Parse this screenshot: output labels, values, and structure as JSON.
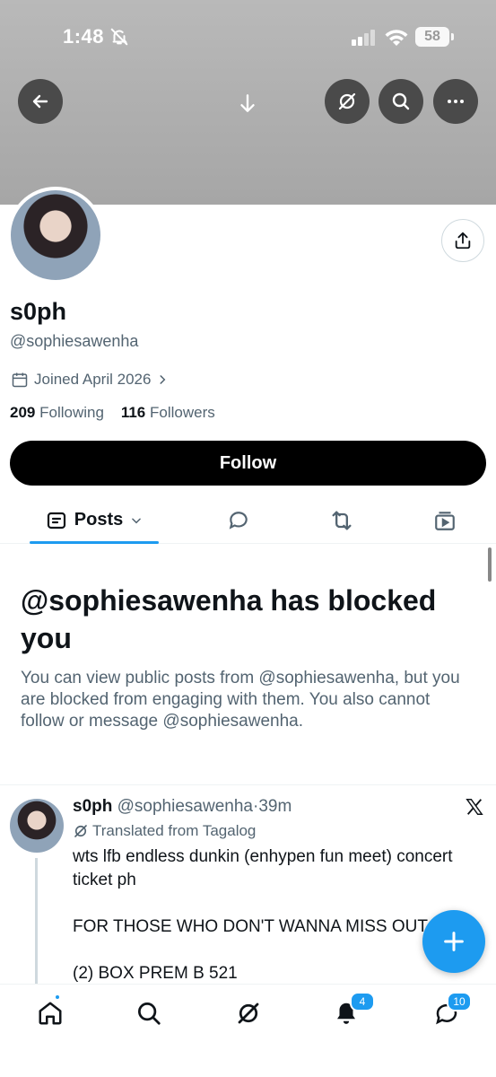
{
  "status_bar": {
    "time": "1:48",
    "battery": "58"
  },
  "profile": {
    "name": "s0ph",
    "handle": "@sophiesawenha",
    "joined": "Joined April 2026",
    "following_count": "209",
    "following_label": "Following",
    "followers_count": "116",
    "followers_label": "Followers",
    "follow_button": "Follow"
  },
  "tabs": {
    "posts_label": "Posts"
  },
  "blocked": {
    "title": "@sophiesawenha has blocked you",
    "description": "You can view public posts from @sophiesawenha, but you are blocked from engaging with them. You also cannot follow or message @sophiesawenha."
  },
  "post": {
    "name": "s0ph",
    "handle": "@sophiesawenha",
    "separator": "·",
    "time": "39m",
    "translated": "Translated from Tagalog",
    "text": "wts lfb endless dunkin (enhypen fun meet) concert ticket ph\n\nFOR THOSE WHO DON'T WANNA MISS OUT\n\n(2) BOX PREM B 521"
  },
  "nav": {
    "notifications_badge": "4",
    "messages_badge": "10"
  },
  "colors": {
    "accent": "#1d9bf0",
    "secondary_text": "#536471",
    "primary_text": "#0f1419"
  }
}
